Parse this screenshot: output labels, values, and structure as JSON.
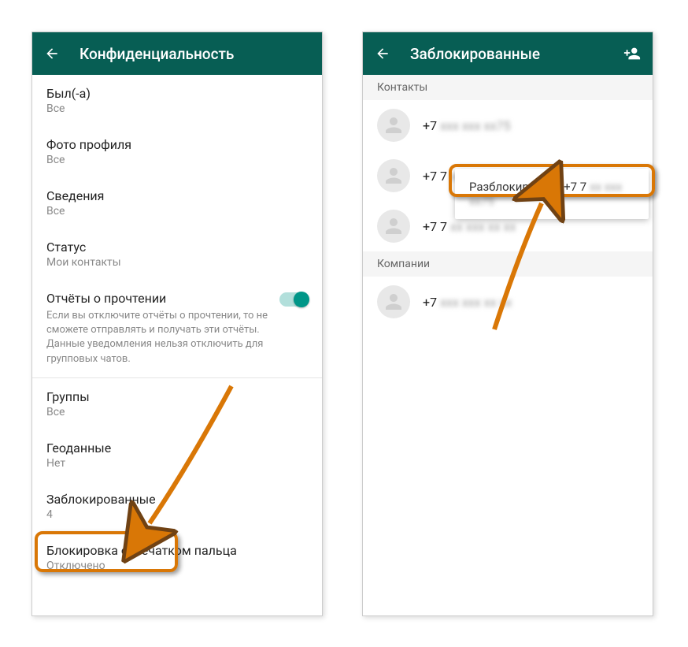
{
  "left": {
    "header": {
      "title": "Конфиденциальность"
    },
    "items": {
      "lastSeen": {
        "title": "Был(-а)",
        "value": "Все"
      },
      "profilePhoto": {
        "title": "Фото профиля",
        "value": "Все"
      },
      "about": {
        "title": "Сведения",
        "value": "Все"
      },
      "status": {
        "title": "Статус",
        "value": "Мои контакты"
      },
      "readReceipts": {
        "title": "Отчёты о прочтении",
        "desc": "Если вы отключите отчёты о прочтении, то не сможете отправлять и получать эти отчёты. Данные уведомления нельзя отключить для групповых чатов."
      },
      "groups": {
        "title": "Группы",
        "value": "Все"
      },
      "liveLocation": {
        "title": "Геоданные",
        "value": "Нет"
      },
      "blocked": {
        "title": "Заблокированные",
        "value": "4"
      },
      "fingerprint": {
        "title": "Блокировка отпечатком пальца",
        "value": "Отключено"
      }
    }
  },
  "right": {
    "header": {
      "title": "Заблокированные"
    },
    "sections": {
      "contacts": "Контакты",
      "companies": "Компании"
    },
    "contacts": [
      {
        "prefix": "+7",
        "rest": "xxx xxx xx75"
      },
      {
        "prefix": "+7 7",
        "rest": "xx xxx xx xx"
      },
      {
        "prefix": "+7 7",
        "rest": "xx xxx xx xx"
      }
    ],
    "companies": [
      {
        "prefix": "+7",
        "rest": "xxx xxx xx xx"
      }
    ],
    "contextMenu": {
      "unblock": "Разблокировать +7 7",
      "unblockRest": "xx xxx xx75"
    }
  }
}
